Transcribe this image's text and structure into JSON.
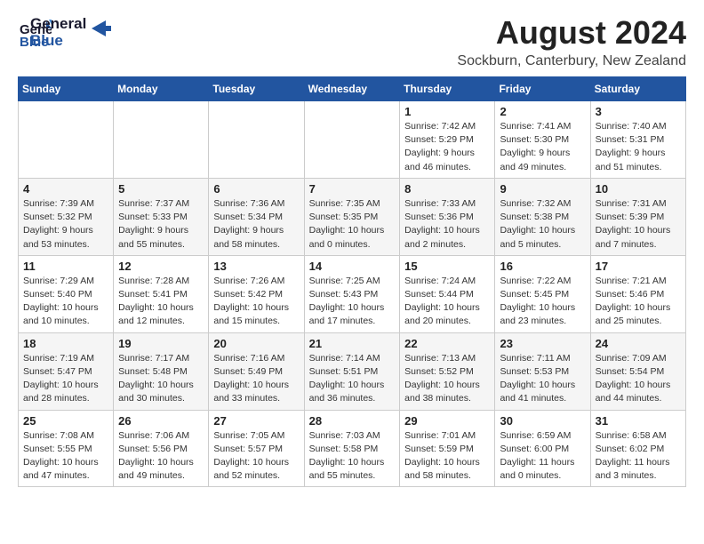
{
  "header": {
    "logo_general": "General",
    "logo_blue": "Blue",
    "main_title": "August 2024",
    "subtitle": "Sockburn, Canterbury, New Zealand"
  },
  "weekdays": [
    "Sunday",
    "Monday",
    "Tuesday",
    "Wednesday",
    "Thursday",
    "Friday",
    "Saturday"
  ],
  "weeks": [
    [
      {
        "day": "",
        "info": ""
      },
      {
        "day": "",
        "info": ""
      },
      {
        "day": "",
        "info": ""
      },
      {
        "day": "",
        "info": ""
      },
      {
        "day": "1",
        "info": "Sunrise: 7:42 AM\nSunset: 5:29 PM\nDaylight: 9 hours\nand 46 minutes."
      },
      {
        "day": "2",
        "info": "Sunrise: 7:41 AM\nSunset: 5:30 PM\nDaylight: 9 hours\nand 49 minutes."
      },
      {
        "day": "3",
        "info": "Sunrise: 7:40 AM\nSunset: 5:31 PM\nDaylight: 9 hours\nand 51 minutes."
      }
    ],
    [
      {
        "day": "4",
        "info": "Sunrise: 7:39 AM\nSunset: 5:32 PM\nDaylight: 9 hours\nand 53 minutes."
      },
      {
        "day": "5",
        "info": "Sunrise: 7:37 AM\nSunset: 5:33 PM\nDaylight: 9 hours\nand 55 minutes."
      },
      {
        "day": "6",
        "info": "Sunrise: 7:36 AM\nSunset: 5:34 PM\nDaylight: 9 hours\nand 58 minutes."
      },
      {
        "day": "7",
        "info": "Sunrise: 7:35 AM\nSunset: 5:35 PM\nDaylight: 10 hours\nand 0 minutes."
      },
      {
        "day": "8",
        "info": "Sunrise: 7:33 AM\nSunset: 5:36 PM\nDaylight: 10 hours\nand 2 minutes."
      },
      {
        "day": "9",
        "info": "Sunrise: 7:32 AM\nSunset: 5:38 PM\nDaylight: 10 hours\nand 5 minutes."
      },
      {
        "day": "10",
        "info": "Sunrise: 7:31 AM\nSunset: 5:39 PM\nDaylight: 10 hours\nand 7 minutes."
      }
    ],
    [
      {
        "day": "11",
        "info": "Sunrise: 7:29 AM\nSunset: 5:40 PM\nDaylight: 10 hours\nand 10 minutes."
      },
      {
        "day": "12",
        "info": "Sunrise: 7:28 AM\nSunset: 5:41 PM\nDaylight: 10 hours\nand 12 minutes."
      },
      {
        "day": "13",
        "info": "Sunrise: 7:26 AM\nSunset: 5:42 PM\nDaylight: 10 hours\nand 15 minutes."
      },
      {
        "day": "14",
        "info": "Sunrise: 7:25 AM\nSunset: 5:43 PM\nDaylight: 10 hours\nand 17 minutes."
      },
      {
        "day": "15",
        "info": "Sunrise: 7:24 AM\nSunset: 5:44 PM\nDaylight: 10 hours\nand 20 minutes."
      },
      {
        "day": "16",
        "info": "Sunrise: 7:22 AM\nSunset: 5:45 PM\nDaylight: 10 hours\nand 23 minutes."
      },
      {
        "day": "17",
        "info": "Sunrise: 7:21 AM\nSunset: 5:46 PM\nDaylight: 10 hours\nand 25 minutes."
      }
    ],
    [
      {
        "day": "18",
        "info": "Sunrise: 7:19 AM\nSunset: 5:47 PM\nDaylight: 10 hours\nand 28 minutes."
      },
      {
        "day": "19",
        "info": "Sunrise: 7:17 AM\nSunset: 5:48 PM\nDaylight: 10 hours\nand 30 minutes."
      },
      {
        "day": "20",
        "info": "Sunrise: 7:16 AM\nSunset: 5:49 PM\nDaylight: 10 hours\nand 33 minutes."
      },
      {
        "day": "21",
        "info": "Sunrise: 7:14 AM\nSunset: 5:51 PM\nDaylight: 10 hours\nand 36 minutes."
      },
      {
        "day": "22",
        "info": "Sunrise: 7:13 AM\nSunset: 5:52 PM\nDaylight: 10 hours\nand 38 minutes."
      },
      {
        "day": "23",
        "info": "Sunrise: 7:11 AM\nSunset: 5:53 PM\nDaylight: 10 hours\nand 41 minutes."
      },
      {
        "day": "24",
        "info": "Sunrise: 7:09 AM\nSunset: 5:54 PM\nDaylight: 10 hours\nand 44 minutes."
      }
    ],
    [
      {
        "day": "25",
        "info": "Sunrise: 7:08 AM\nSunset: 5:55 PM\nDaylight: 10 hours\nand 47 minutes."
      },
      {
        "day": "26",
        "info": "Sunrise: 7:06 AM\nSunset: 5:56 PM\nDaylight: 10 hours\nand 49 minutes."
      },
      {
        "day": "27",
        "info": "Sunrise: 7:05 AM\nSunset: 5:57 PM\nDaylight: 10 hours\nand 52 minutes."
      },
      {
        "day": "28",
        "info": "Sunrise: 7:03 AM\nSunset: 5:58 PM\nDaylight: 10 hours\nand 55 minutes."
      },
      {
        "day": "29",
        "info": "Sunrise: 7:01 AM\nSunset: 5:59 PM\nDaylight: 10 hours\nand 58 minutes."
      },
      {
        "day": "30",
        "info": "Sunrise: 6:59 AM\nSunset: 6:00 PM\nDaylight: 11 hours\nand 0 minutes."
      },
      {
        "day": "31",
        "info": "Sunrise: 6:58 AM\nSunset: 6:02 PM\nDaylight: 11 hours\nand 3 minutes."
      }
    ]
  ]
}
